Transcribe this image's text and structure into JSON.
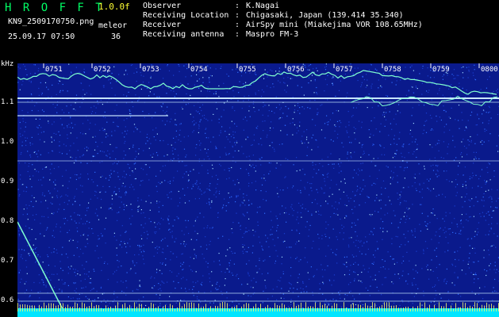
{
  "header": {
    "app_title": "H R O F F T",
    "version": "1.0.0f",
    "filename": "KN9_2509170750.png",
    "meleor_label": "meleor",
    "datetime": "25.09.17 07:50",
    "meleor_count": "36"
  },
  "info": [
    {
      "key": "Observer",
      "value": "K.Nagai"
    },
    {
      "key": "Receiving Location",
      "value": "Chigasaki, Japan (139.414 35.340)"
    },
    {
      "key": "Receiver",
      "value": "AirSpy mini (Miakejima VOR 108.65MHz)"
    },
    {
      "key": "Receiving antenna",
      "value": "Maspro FM-3"
    }
  ],
  "axis": {
    "unit": "kHz",
    "y_ticks": [
      "1.1",
      "1.0",
      "0.9",
      "0.8",
      "0.7",
      "0.6"
    ],
    "time_ticks": [
      "0751",
      "0752",
      "0753",
      "0754",
      "0755",
      "0756",
      "0757",
      "0758",
      "0759",
      "0800"
    ]
  },
  "colors": {
    "background": "#0a1a8c",
    "trace": "#7fffd0",
    "line": "#c8e6ff",
    "bottom_band": "#00e5ff",
    "title_green": "#00ff66",
    "version_yellow": "#ffff33"
  }
}
